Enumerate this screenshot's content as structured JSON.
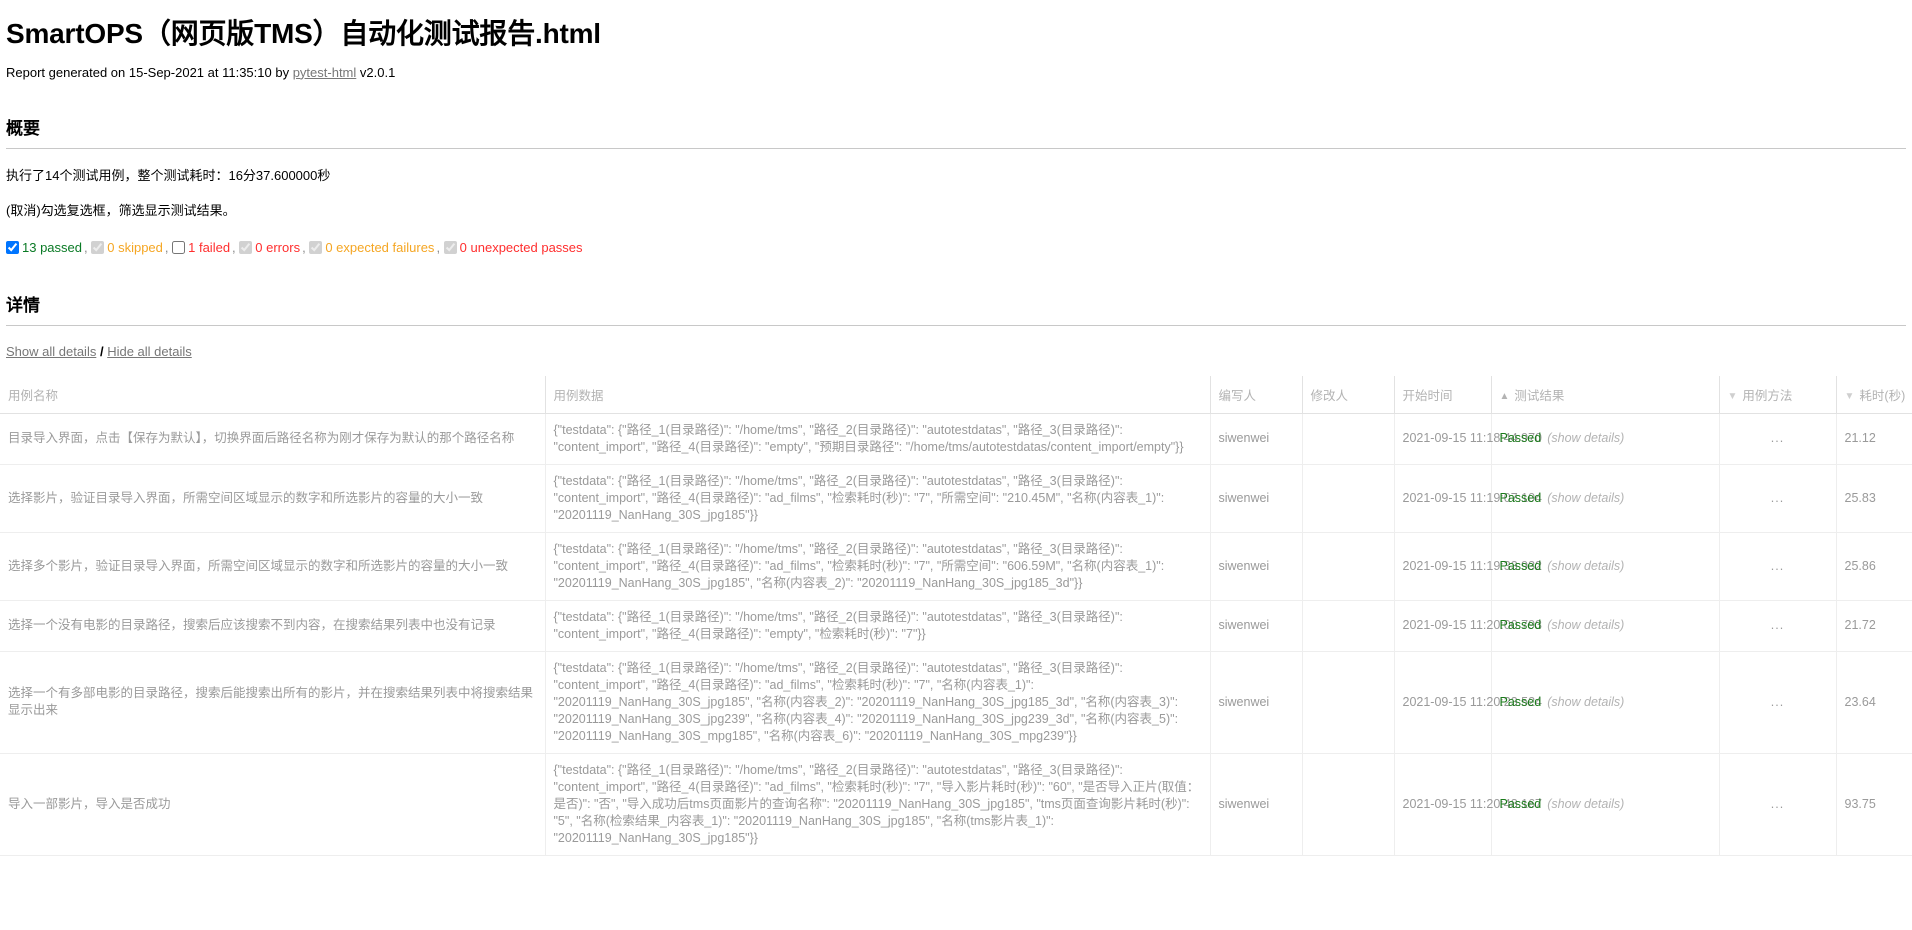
{
  "header": {
    "title": "SmartOPS（网页版TMS）自动化测试报告.html",
    "generated_prefix": "Report generated on 15-Sep-2021 at 11:35:10 by ",
    "generator_link": "pytest-html",
    "generator_version": " v2.0.1"
  },
  "summary": {
    "heading": "概要",
    "line1": "执行了14个测试用例，整个测试耗时：16分37.600000秒",
    "line2": "(取消)勾选复选框，筛选显示测试结果。",
    "filters": [
      {
        "label": "13 passed",
        "color_class": "c-passed",
        "checked": true,
        "disabled": false
      },
      {
        "label": "0 skipped",
        "color_class": "c-skipped",
        "checked": true,
        "disabled": true
      },
      {
        "label": "1 failed",
        "color_class": "c-failed",
        "checked": false,
        "disabled": false
      },
      {
        "label": "0 errors",
        "color_class": "c-errors",
        "checked": true,
        "disabled": true
      },
      {
        "label": "0 expected failures",
        "color_class": "c-xfail",
        "checked": true,
        "disabled": true
      },
      {
        "label": "0 unexpected passes",
        "color_class": "c-xpass",
        "checked": true,
        "disabled": true
      }
    ]
  },
  "details": {
    "heading": "详情",
    "show_all": "Show all details",
    "separator": "/",
    "hide_all": "Hide all details"
  },
  "table": {
    "columns": [
      {
        "label": "用例名称",
        "arrow": "",
        "cls": "col-name"
      },
      {
        "label": "用例数据",
        "arrow": "",
        "cls": "col-data"
      },
      {
        "label": "编写人",
        "arrow": "",
        "cls": "col-author"
      },
      {
        "label": "修改人",
        "arrow": "",
        "cls": "col-modifier"
      },
      {
        "label": "开始时间",
        "arrow": "",
        "cls": "col-start"
      },
      {
        "label": "测试结果",
        "arrow": "▲",
        "cls": "col-result"
      },
      {
        "label": "用例方法",
        "arrow": "▼",
        "cls": "col-method"
      },
      {
        "label": "耗时(秒)",
        "arrow": "▼",
        "cls": "col-dur"
      }
    ],
    "rows": [
      {
        "name": "目录导入界面，点击【保存为默认】，切换界面后路径名称为刚才保存为默认的那个路径名称",
        "data": "{\"testdata\": {\"路径_1(目录路径)\": \"/home/tms\", \"路径_2(目录路径)\": \"autotestdatas\", \"路径_3(目录路径)\": \"content_import\", \"路径_4(目录路径)\": \"empty\", \"预期目录路径\": \"/home/tms/autotestdatas/content_import/empty\"}}",
        "author": "siwenwei",
        "modifier": "",
        "start": "2021-09-15 11:18:44.970",
        "result": "Passed",
        "result_class": "result-passed",
        "show_details": "(show details)",
        "method": "...",
        "duration": "21.12"
      },
      {
        "name": "选择影片，验证目录导入界面，所需空间区域显示的数字和所选影片的容量的大小一致",
        "data": "{\"testdata\": {\"路径_1(目录路径)\": \"/home/tms\", \"路径_2(目录路径)\": \"autotestdatas\", \"路径_3(目录路径)\": \"content_import\", \"路径_4(目录路径)\": \"ad_films\", \"检索耗时(秒)\": \"7\", \"所需空间\": \"210.45M\", \"名称(内容表_1)\": \"20201119_NanHang_30S_jpg185\"}}",
        "author": "siwenwei",
        "modifier": "",
        "start": "2021-09-15 11:19:07.104",
        "result": "Passed",
        "result_class": "result-passed",
        "show_details": "(show details)",
        "method": "...",
        "duration": "25.83"
      },
      {
        "name": "选择多个影片，验证目录导入界面，所需空间区域显示的数字和所选影片的容量的大小一致",
        "data": "{\"testdata\": {\"路径_1(目录路径)\": \"/home/tms\", \"路径_2(目录路径)\": \"autotestdatas\", \"路径_3(目录路径)\": \"content_import\", \"路径_4(目录路径)\": \"ad_films\", \"检索耗时(秒)\": \"7\", \"所需空间\": \"606.59M\", \"名称(内容表_1)\": \"20201119_NanHang_30S_jpg185\", \"名称(内容表_2)\": \"20201119_NanHang_30S_jpg185_3d\"}}",
        "author": "siwenwei",
        "modifier": "",
        "start": "2021-09-15 11:19:33.932",
        "result": "Passed",
        "result_class": "result-passed",
        "show_details": "(show details)",
        "method": "...",
        "duration": "25.86"
      },
      {
        "name": "选择一个没有电影的目录路径，搜索后应该搜索不到内容，在搜索结果列表中也没有记录",
        "data": "{\"testdata\": {\"路径_1(目录路径)\": \"/home/tms\", \"路径_2(目录路径)\": \"autotestdatas\", \"路径_3(目录路径)\": \"content_import\", \"路径_4(目录路径)\": \"empty\", \"检索耗时(秒)\": \"7\"}}",
        "author": "siwenwei",
        "modifier": "",
        "start": "2021-09-15 11:20:00.793",
        "result": "Passed",
        "result_class": "result-passed",
        "show_details": "(show details)",
        "method": "...",
        "duration": "21.72"
      },
      {
        "name": "选择一个有多部电影的目录路径，搜索后能搜索出所有的影片，并在搜索结果列表中将搜索结果显示出来",
        "data": "{\"testdata\": {\"路径_1(目录路径)\": \"/home/tms\", \"路径_2(目录路径)\": \"autotestdatas\", \"路径_3(目录路径)\": \"content_import\", \"路径_4(目录路径)\": \"ad_films\", \"检索耗时(秒)\": \"7\", \"名称(内容表_1)\": \"20201119_NanHang_30S_jpg185\", \"名称(内容表_2)\": \"20201119_NanHang_30S_jpg185_3d\", \"名称(内容表_3)\": \"20201119_NanHang_30S_jpg239\", \"名称(内容表_4)\": \"20201119_NanHang_30S_jpg239_3d\", \"名称(内容表_5)\": \"20201119_NanHang_30S_mpg185\", \"名称(内容表_6)\": \"20201119_NanHang_30S_mpg239\"}}",
        "author": "siwenwei",
        "modifier": "",
        "start": "2021-09-15 11:20:23.524",
        "result": "Passed",
        "result_class": "result-passed",
        "show_details": "(show details)",
        "method": "...",
        "duration": "23.64"
      },
      {
        "name": "导入一部影片，导入是否成功",
        "data": "{\"testdata\": {\"路径_1(目录路径)\": \"/home/tms\", \"路径_2(目录路径)\": \"autotestdatas\", \"路径_3(目录路径)\": \"content_import\", \"路径_4(目录路径)\": \"ad_films\", \"检索耗时(秒)\": \"7\", \"导入影片耗时(秒)\": \"60\", \"是否导入正片(取值：是否)\": \"否\", \"导入成功后tms页面影片的查询名称\": \"20201119_NanHang_30S_jpg185\", \"tms页面查询影片耗时(秒)\": \"5\", \"名称(检索结果_内容表_1)\": \"20201119_NanHang_30S_jpg185\", \"名称(tms影片表_1)\": \"20201119_NanHang_30S_jpg185\"}}",
        "author": "siwenwei",
        "modifier": "",
        "start": "2021-09-15 11:20:48.167",
        "result": "Passed",
        "result_class": "result-passed",
        "show_details": "(show details)",
        "method": "...",
        "duration": "93.75"
      }
    ]
  }
}
